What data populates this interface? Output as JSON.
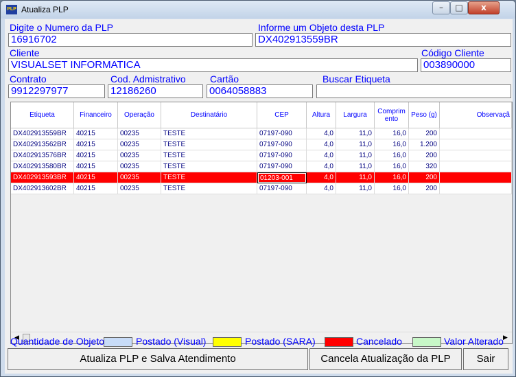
{
  "window": {
    "app_icon_text": "PLP",
    "title": "Atualiza PLP",
    "controls": {
      "minimize": "–",
      "maximize": "□",
      "close": "x"
    }
  },
  "form": {
    "plp_number_label": "Digite o Numero da PLP",
    "plp_number_value": "16916702",
    "object_label": "Informe um Objeto desta PLP",
    "object_value": "DX402913559BR",
    "client_label": "Cliente",
    "client_value": "VISUALSET INFORMATICA",
    "client_code_label": "Código Cliente",
    "client_code_value": "003890000",
    "contract_label": "Contrato",
    "contract_value": "9912297977",
    "admin_code_label": "Cod. Admistrativo",
    "admin_code_value": "12186260",
    "card_label": "Cartão",
    "card_value": "0064058883",
    "search_label_label": "Buscar Etiqueta",
    "search_label_value": ""
  },
  "table": {
    "headers": [
      "Etiqueta",
      "Financeiro",
      "Operação",
      "Destinatário",
      "CEP",
      "Altura",
      "Largura",
      "Comprim ento",
      "Peso (g)",
      "Observaçã"
    ],
    "rows": [
      [
        "DX402913559BR",
        "40215",
        "00235",
        "TESTE",
        "07197-090",
        "4,0",
        "11,0",
        "16,0",
        "200",
        ""
      ],
      [
        "DX402913562BR",
        "40215",
        "00235",
        "TESTE",
        "07197-090",
        "4,0",
        "11,0",
        "16,0",
        "1.200",
        ""
      ],
      [
        "DX402913576BR",
        "40215",
        "00235",
        "TESTE",
        "07197-090",
        "4,0",
        "11,0",
        "16,0",
        "200",
        ""
      ],
      [
        "DX402913580BR",
        "40215",
        "00235",
        "TESTE",
        "07197-090",
        "4,0",
        "11,0",
        "16,0",
        "320",
        ""
      ],
      [
        "DX402913593BR",
        "40215",
        "00235",
        "TESTE",
        "01203-001",
        "4,0",
        "11,0",
        "16,0",
        "200",
        ""
      ],
      [
        "DX402913602BR",
        "40215",
        "00235",
        "TESTE",
        "07197-090",
        "4,0",
        "11,0",
        "16,0",
        "200",
        ""
      ]
    ],
    "selected_row": 4,
    "scroll_left": "◀",
    "scroll_right": "▶"
  },
  "legend": {
    "quantity_label": "Quantidade de Objetos",
    "items": [
      {
        "label": "Postado (Visual)",
        "color": "#c8dcf8"
      },
      {
        "label": "Postado (SARA)",
        "color": "#ffff00"
      },
      {
        "label": "Cancelado",
        "color": "#ff0000"
      },
      {
        "label": "Valor Alterado",
        "color": "#c8f8c8"
      }
    ]
  },
  "buttons": {
    "update": "Atualiza PLP e Salva Atendimento",
    "cancel": "Cancela Atualização da PLP",
    "exit": "Sair"
  }
}
